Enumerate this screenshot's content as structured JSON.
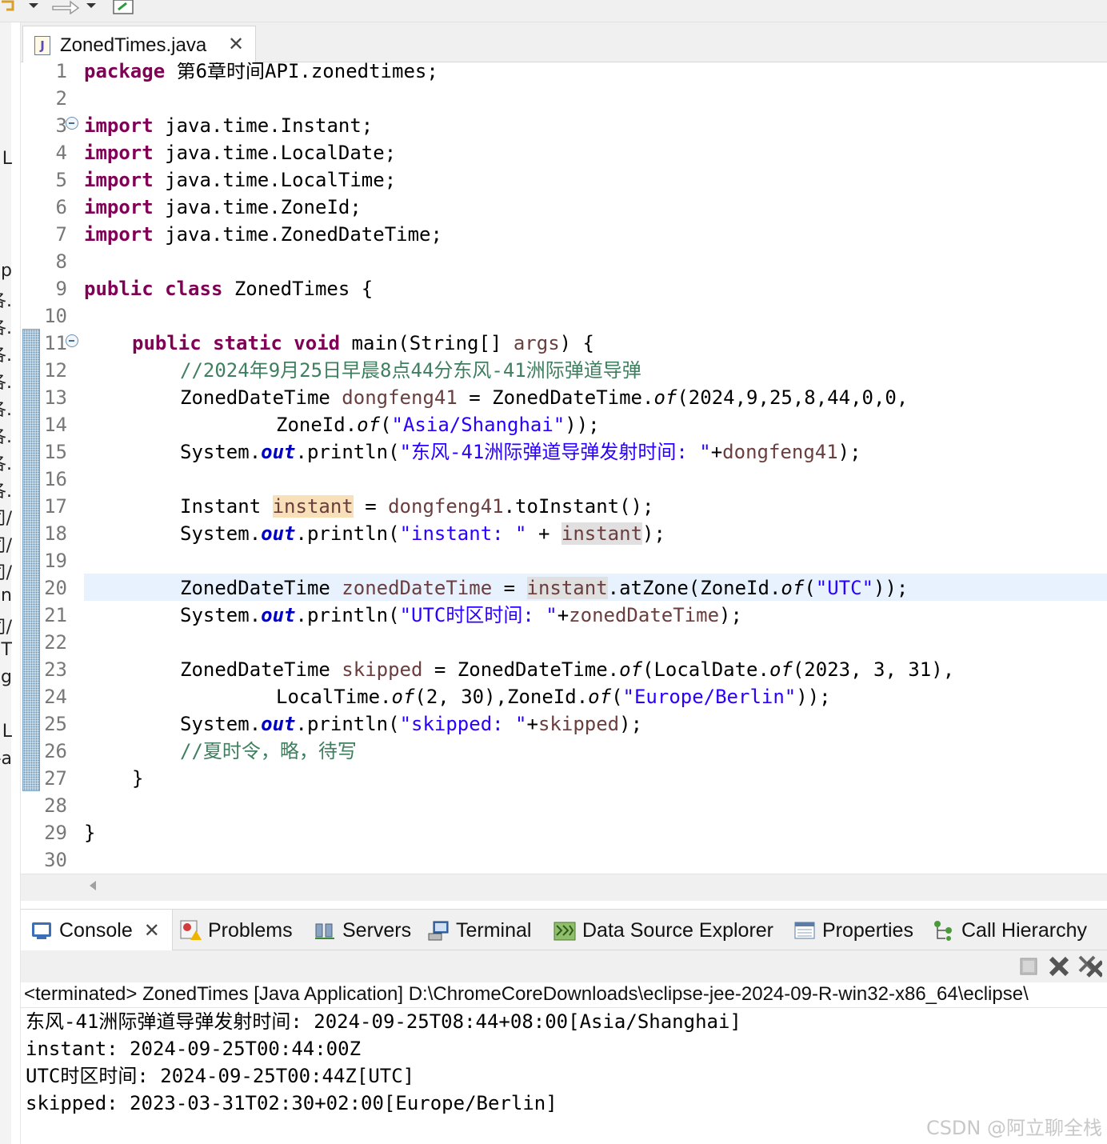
{
  "editor": {
    "tab_label": "ZonedTimes.java",
    "line_numbers": [
      "1",
      "2",
      "3",
      "4",
      "5",
      "6",
      "7",
      "8",
      "9",
      "10",
      "11",
      "12",
      "13",
      "14",
      "15",
      "16",
      "17",
      "18",
      "19",
      "20",
      "21",
      "22",
      "23",
      "24",
      "25",
      "26",
      "27",
      "28",
      "29",
      "30"
    ]
  },
  "code": {
    "l1": {
      "kw": "package",
      "rest": " 第6章时间API.zonedtimes;"
    },
    "l3": {
      "kw": "import",
      "rest": " java.time.Instant;"
    },
    "l4": {
      "kw": "import",
      "rest": " java.time.LocalDate;"
    },
    "l5": {
      "kw": "import",
      "rest": " java.time.LocalTime;"
    },
    "l6": {
      "kw": "import",
      "rest": " java.time.ZoneId;"
    },
    "l7": {
      "kw": "import",
      "rest": " java.time.ZonedDateTime;"
    },
    "l9": {
      "kw": "public class",
      "rest": " ZonedTimes {"
    },
    "l11": {
      "kw": "public static void",
      "rest": " main(String[] ",
      "arg": "args",
      "end": ") {"
    },
    "l12": {
      "comment": "//2024年9月25日早晨8点44分东风-41洲际弹道导弹"
    },
    "l13": {
      "type": "ZonedDateTime ",
      "var": "dongfeng41",
      "mid": " = ZonedDateTime.",
      "method": "of",
      "end": "(2024,9,25,8,44,0,0,"
    },
    "l14": {
      "pre": "ZoneId.",
      "method": "of",
      "open": "(",
      "str": "\"Asia/Shanghai\"",
      "end": "));"
    },
    "l15": {
      "pre": "System.",
      "field": "out",
      "mid": ".println(",
      "str": "\"东风-41洲际弹道导弹发射时间: \"",
      "plus": "+",
      "var": "dongfeng41",
      "end": ");"
    },
    "l17": {
      "type": "Instant ",
      "var": "instant",
      "mid": " = ",
      "var2": "dongfeng41",
      "end": ".toInstant();"
    },
    "l18": {
      "pre": "System.",
      "field": "out",
      "mid": ".println(",
      "str": "\"instant: \"",
      "plus": " + ",
      "var": "instant",
      "end": ");"
    },
    "l20": {
      "type": "ZonedDateTime ",
      "var": "zonedDateTime",
      "mid": " = ",
      "var2": "instant",
      "mid2": ".atZone(ZoneId.",
      "method": "of",
      "open": "(",
      "str": "\"UTC\"",
      "end": "));"
    },
    "l21": {
      "pre": "System.",
      "field": "out",
      "mid": ".println(",
      "str": "\"UTC时区时间: \"",
      "plus": "+",
      "var": "zonedDateTime",
      "end": ");"
    },
    "l23": {
      "type": "ZonedDateTime ",
      "var": "skipped",
      "mid": " = ZonedDateTime.",
      "method": "of",
      "mid2": "(LocalDate.",
      "method2": "of",
      "end": "(2023, 3, 31),"
    },
    "l24": {
      "pre": "LocalTime.",
      "method": "of",
      "mid": "(2, 30),ZoneId.",
      "method2": "of",
      "open": "(",
      "str": "\"Europe/Berlin\"",
      "end": "));"
    },
    "l25": {
      "pre": "System.",
      "field": "out",
      "mid": ".println(",
      "str": "\"skipped: \"",
      "plus": "+",
      "var": "skipped",
      "end": ");"
    },
    "l26": {
      "comment": "//夏时令，略，待写"
    },
    "l27": {
      "text": "}"
    },
    "l29": {
      "text": "}"
    }
  },
  "panel": {
    "tabs": [
      "Console",
      "Problems",
      "Servers",
      "Terminal",
      "Data Source Explorer",
      "Properties",
      "Call Hierarchy"
    ]
  },
  "console": {
    "header": "<terminated> ZonedTimes [Java Application] D:\\ChromeCoreDownloads\\eclipse-jee-2024-09-R-win32-x86_64\\eclipse\\",
    "lines": [
      "东风-41洲际弹道导弹发射时间: 2024-09-25T08:44+08:00[Asia/Shanghai]",
      "instant: 2024-09-25T00:44:00Z",
      "UTC时区时间: 2024-09-25T00:44Z[UTC]",
      "skipped: 2023-03-31T02:30+02:00[Europe/Berlin]"
    ]
  },
  "left_fragments": [
    "L",
    "p",
    "各.",
    "各.",
    "各.",
    "各.",
    "各.",
    "各.",
    "各.",
    "各.",
    "司/",
    "司/",
    "司/",
    "n",
    "司/",
    "IT",
    "g",
    "L",
    "-a"
  ],
  "watermark": "CSDN @阿立聊全栈"
}
